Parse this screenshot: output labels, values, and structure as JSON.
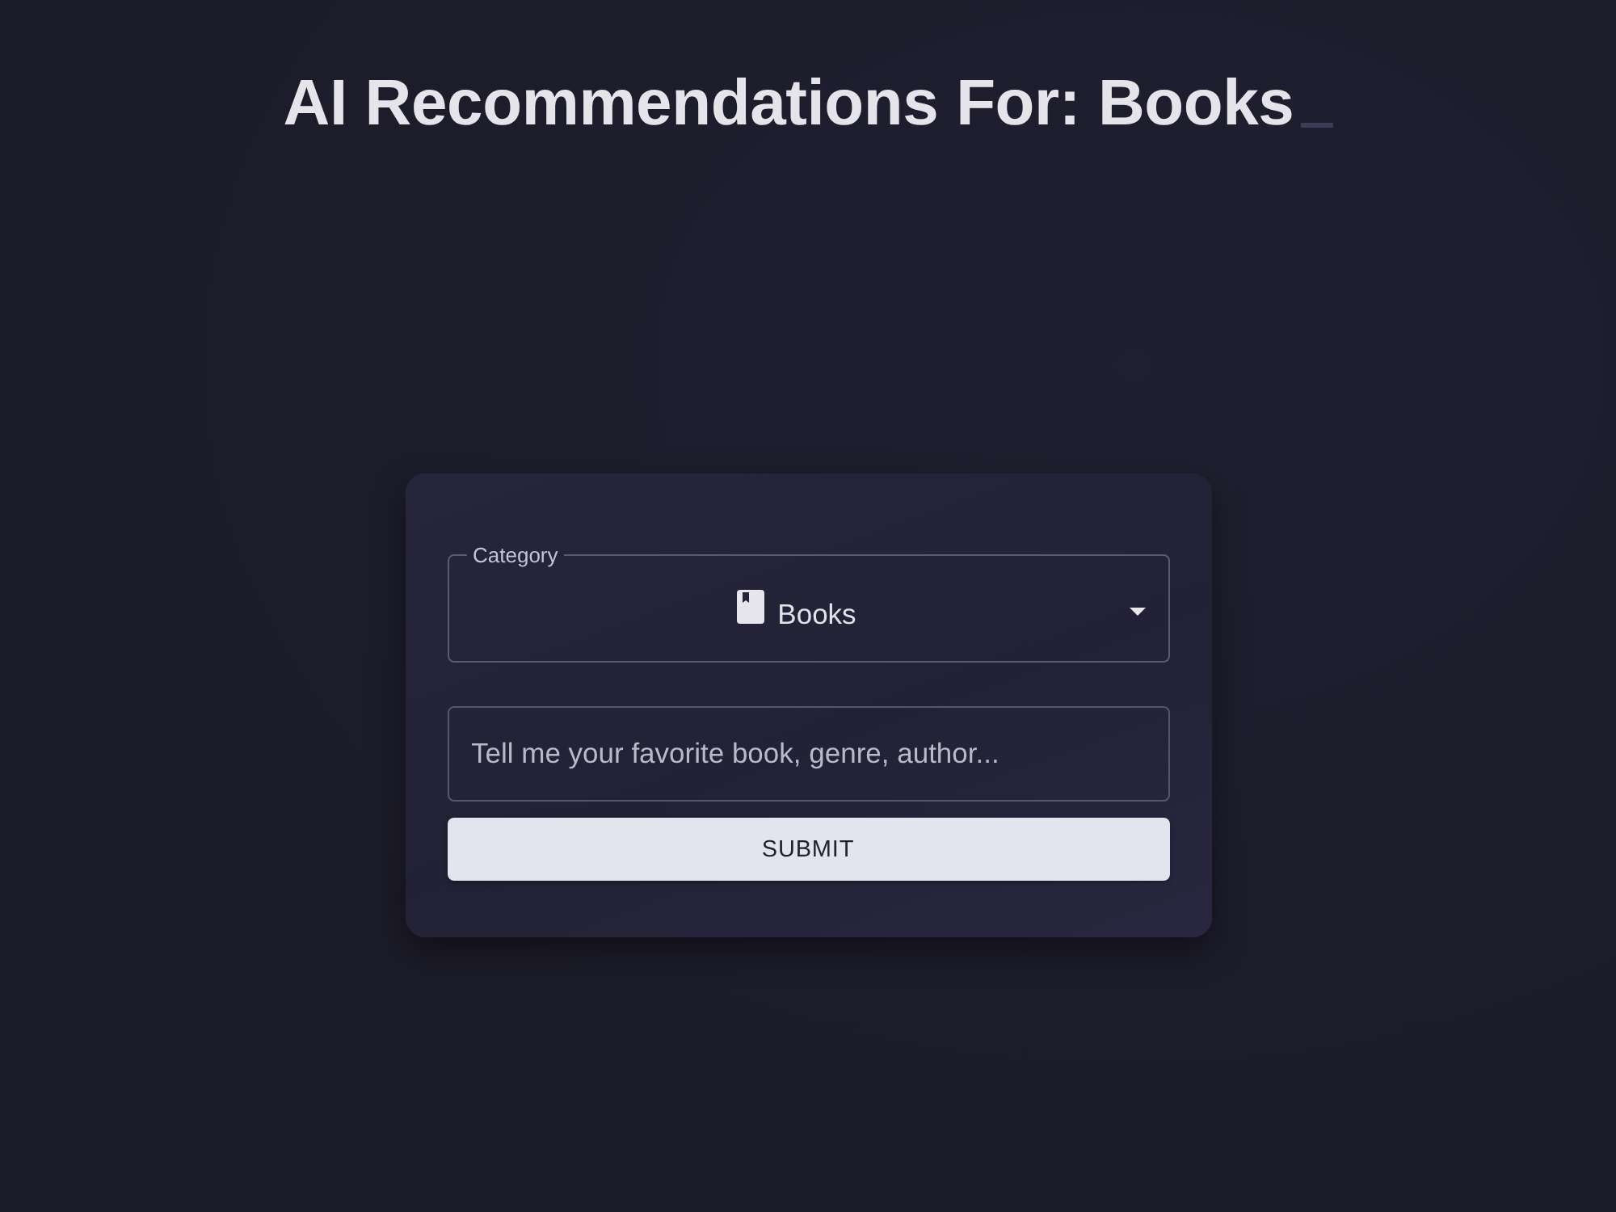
{
  "header": {
    "title": "AI Recommendations For: Books",
    "cursor_visible": true
  },
  "form": {
    "category": {
      "label": "Category",
      "value": "Books"
    },
    "prompt": {
      "placeholder": "Tell me your favorite book, genre, author..."
    },
    "submit": {
      "label": "SUBMIT"
    }
  }
}
